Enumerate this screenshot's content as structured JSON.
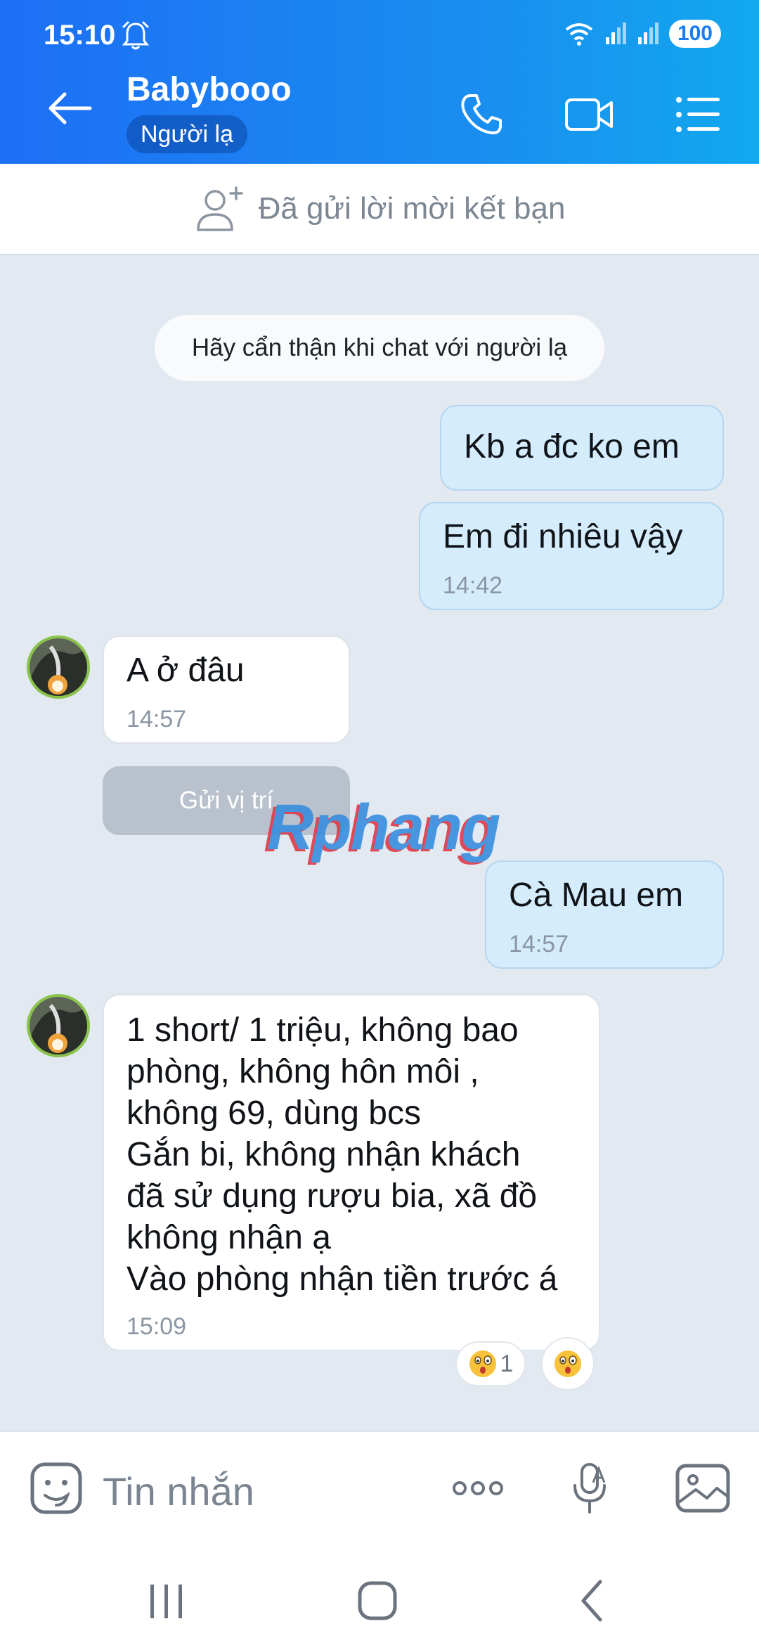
{
  "status_bar": {
    "time": "15:10",
    "battery": "100"
  },
  "header": {
    "contact_name": "Babybooo",
    "contact_badge": "Người lạ",
    "icons": [
      "back-arrow-icon",
      "phone-icon",
      "video-call-icon",
      "menu-list-icon"
    ]
  },
  "friend_request": {
    "text": "Đã gửi lời mời kết bạn"
  },
  "chat": {
    "notice": "Hãy cẩn thận khi chat với người lạ",
    "messages": [
      {
        "direction": "out",
        "text": "Kb a đc ko em",
        "time": ""
      },
      {
        "direction": "out",
        "text": "Em đi nhiêu vậy",
        "time": "14:42"
      },
      {
        "direction": "in",
        "text": "A ở đâu",
        "time": "14:57"
      },
      {
        "direction": "out",
        "text": "Cà Mau em",
        "time": "14:57"
      },
      {
        "direction": "in",
        "text": "1 short/ 1 triệu, không bao\nphòng, không hôn môi ,\nkhông 69, dùng bcs\nGắn bi, không nhận khách\nđã sử dụng rượu bia, xã đồ\nkhông nhận ạ\nVào phòng nhận tiền trước á",
        "time": "15:09"
      }
    ],
    "send_location": "Gửi vị trí",
    "reaction_count": "1",
    "watermark": "Rphang"
  },
  "input_bar": {
    "placeholder": "Tin nhắn"
  },
  "colors": {
    "header_start": "#1d6ff5",
    "header_end": "#12a8ee",
    "outgoing_bubble": "#d4ecfc",
    "chat_background": "#e2e9f1"
  }
}
